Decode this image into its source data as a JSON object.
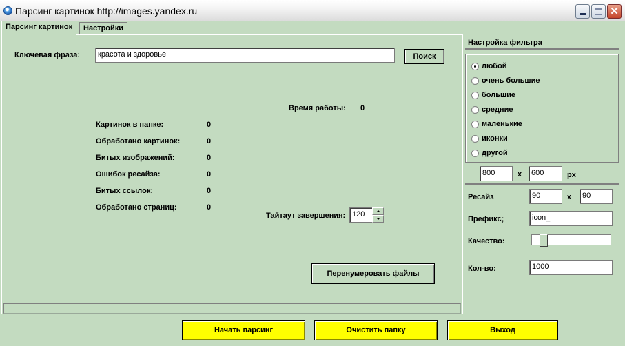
{
  "window": {
    "title": "Парсинг картинок http://images.yandex.ru",
    "controls": {
      "minimize": "minimize-icon",
      "maximize": "maximize-icon",
      "close": "close-icon"
    }
  },
  "tabs": [
    {
      "label": "Парсинг картинок",
      "active": true
    },
    {
      "label": "Настройки",
      "active": false
    }
  ],
  "search": {
    "label": "Ключевая фраза:",
    "value": "красота и здоровье",
    "button": "Поиск"
  },
  "work_time": {
    "label": "Время работы:",
    "value": "0"
  },
  "stats": [
    {
      "label": "Картинок в папке:",
      "value": "0"
    },
    {
      "label": "Обработано картинок:",
      "value": "0"
    },
    {
      "label": "Битых изображений:",
      "value": "0"
    },
    {
      "label": "Ошибок ресайза:",
      "value": "0"
    },
    {
      "label": "Битых ссылок:",
      "value": "0"
    },
    {
      "label": "Обработано страниц:",
      "value": "0"
    }
  ],
  "timeout": {
    "label": "Тайтаут завершения:",
    "value": "120"
  },
  "renumber_button": "Перенумеровать файлы",
  "filter": {
    "title": "Настройка фильтра",
    "options": [
      "любой",
      "очень большие",
      "большие",
      "средние",
      "маленькие",
      "иконки",
      "другой"
    ],
    "selected": "любой",
    "custom_width": "800",
    "custom_height": "600",
    "separator": "x",
    "unit": "px"
  },
  "resize": {
    "label": "Ресайз",
    "width": "90",
    "height": "90",
    "separator": "x",
    "prefix_label": "Префикс;",
    "prefix_value": "icon_",
    "quality_label": "Качество:",
    "quality_level": 0.12,
    "count_label": "Кол-во:",
    "count_value": "1000"
  },
  "bottom_buttons": {
    "start": "Начать парсинг",
    "clear": "Очистить папку",
    "exit": "Выход"
  },
  "colors": {
    "background": "#c3dbc0",
    "accent_button": "#ffff00"
  }
}
